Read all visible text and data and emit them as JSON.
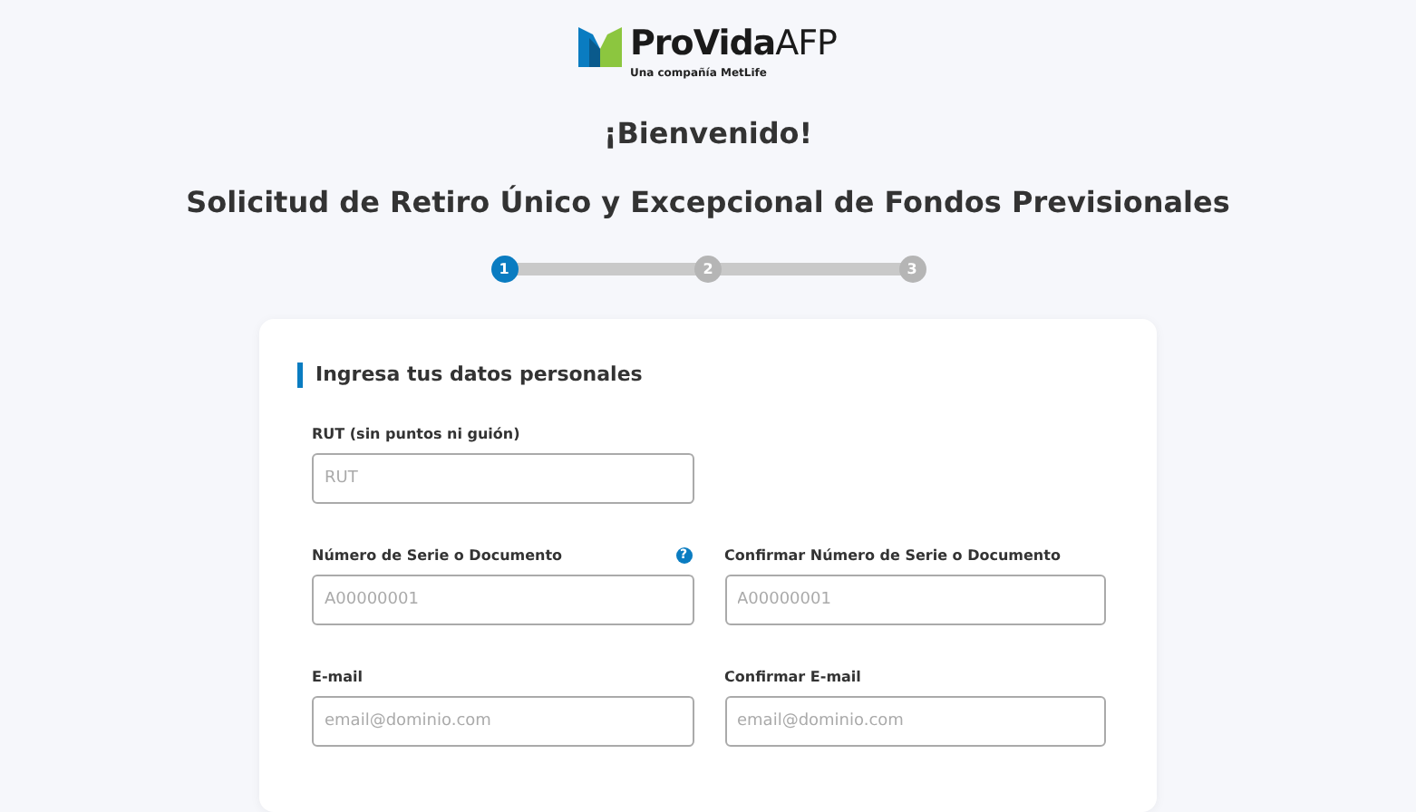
{
  "logo": {
    "brand": "ProVida",
    "suffix": "AFP",
    "tagline": "Una compañía MetLife"
  },
  "welcome": "¡Bienvenido!",
  "title": "Solicitud de Retiro Único y Excepcional de Fondos Previsionales",
  "steps": [
    {
      "label": "1",
      "selected": true
    },
    {
      "label": "2",
      "selected": false
    },
    {
      "label": "3",
      "selected": false
    }
  ],
  "form": {
    "heading": "Ingresa tus datos personales",
    "rows": [
      [
        {
          "label": "RUT (sin puntos ni guión)",
          "placeholder": "RUT"
        }
      ],
      [
        {
          "label": "Número de Serie o Documento",
          "placeholder": "A00000001",
          "help": "?"
        },
        {
          "label": "Confirmar Número de Serie o Documento",
          "placeholder": "A00000001"
        }
      ],
      [
        {
          "label": "E-mail",
          "placeholder": "email@dominio.com"
        },
        {
          "label": "Confirmar E-mail",
          "placeholder": "email@dominio.com"
        }
      ]
    ]
  }
}
